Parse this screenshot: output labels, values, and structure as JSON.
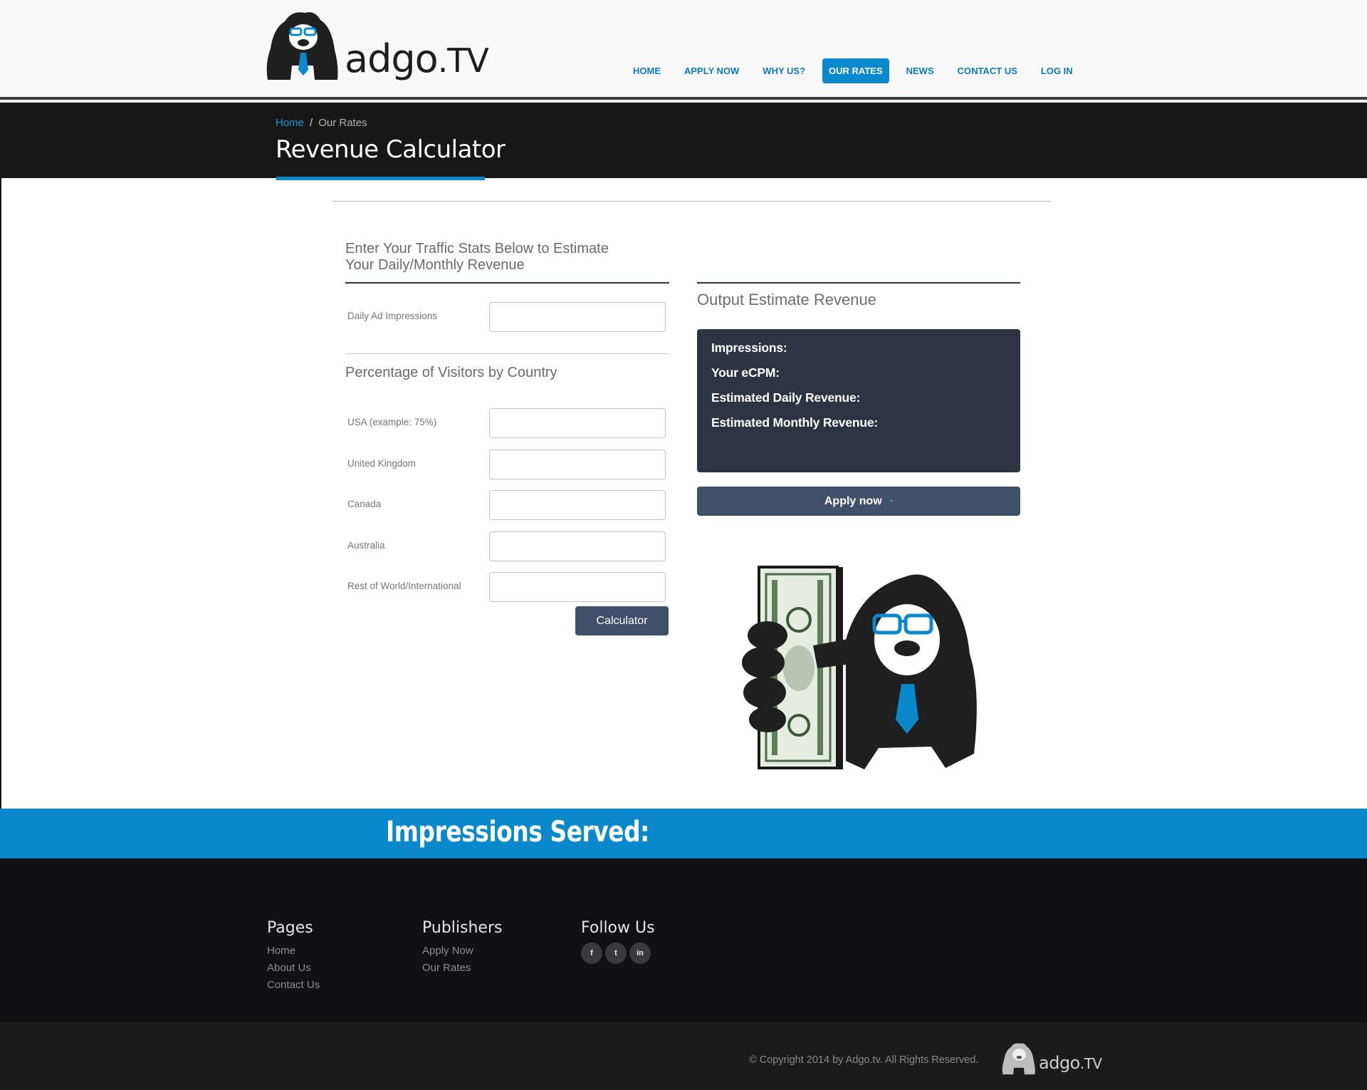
{
  "brand": {
    "logo_text_main": "adgo",
    "logo_text_suffix": ".TV",
    "accent_color": "#0a88cc",
    "dark_color": "#2c3443"
  },
  "nav": {
    "items": [
      "HOME",
      "APPLY NOW",
      "WHY US?",
      "OUR RATES",
      "NEWS",
      "CONTACT US",
      "LOG IN"
    ],
    "active": "OUR RATES"
  },
  "breadcrumb": {
    "home": "Home",
    "separator": "/",
    "current": "Our Rates"
  },
  "page_title": "Revenue Calculator",
  "form": {
    "heading_line1": "Enter Your Traffic Stats Below to Estimate",
    "heading_line2": "Your Daily/Monthly Revenue",
    "impressions_label": "Daily Ad Impressions",
    "impressions_value": "",
    "countries_heading": "Percentage of Visitors by Country",
    "fields": [
      {
        "label": "USA (example: 75%)",
        "value": ""
      },
      {
        "label": "United Kingdom",
        "value": ""
      },
      {
        "label": "Canada",
        "value": ""
      },
      {
        "label": "Australia",
        "value": ""
      },
      {
        "label": "Rest of World/International",
        "value": ""
      }
    ],
    "calculate_button": "Calculator"
  },
  "output": {
    "heading": "Output Estimate Revenue",
    "lines": [
      "Impressions:",
      "Your eCPM:",
      "Estimated Daily Revenue:",
      "Estimated Monthly Revenue:"
    ],
    "apply_button": "Apply now",
    "apply_button_dot": "·"
  },
  "impressions_band": {
    "text": "Impressions Served:"
  },
  "footer": {
    "pages": {
      "title": "Pages",
      "links": [
        "Home",
        "About Us",
        "Contact Us"
      ]
    },
    "publishers": {
      "title": "Publishers",
      "links": [
        "Apply Now",
        "Our Rates"
      ]
    },
    "follow": {
      "title": "Follow Us",
      "icons": [
        "facebook-icon",
        "twitter-icon",
        "linkedin-icon"
      ],
      "glyphs": [
        "f",
        "t",
        "in"
      ]
    },
    "copyright": "© Copyright 2014 by Adgo.tv.  All Rights Reserved."
  }
}
